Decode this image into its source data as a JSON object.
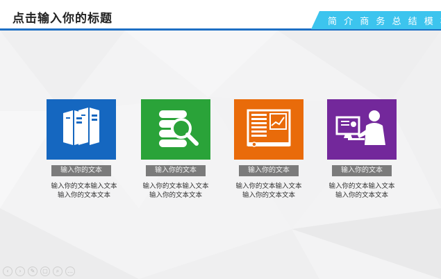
{
  "header": {
    "title": "点击输入你的标题",
    "tag": "简 介 商 务 总 结 模 板"
  },
  "colors": {
    "header_line": "#1d6fc4",
    "tag_bg": "#3cc4ee",
    "card1": "#1567c0",
    "card2": "#2aa339",
    "card3": "#e96b0a",
    "card4": "#73289b"
  },
  "cards": [
    {
      "icon": "server-icon",
      "label": "输入你的文本",
      "desc1": "输入你的文本输入文本",
      "desc2": "输入你的文本文本"
    },
    {
      "icon": "database-search-icon",
      "label": "输入你的文本",
      "desc1": "输入你的文本输入文本",
      "desc2": "输入你的文本文本"
    },
    {
      "icon": "spreadsheet-chart-icon",
      "label": "输入你的文本",
      "desc1": "输入你的文本输入文本",
      "desc2": "输入你的文本文本"
    },
    {
      "icon": "user-computer-icon",
      "label": "输入你的文本",
      "desc1": "输入你的文本输入文本",
      "desc2": "输入你的文本文本"
    }
  ],
  "controls": [
    "previous-icon",
    "next-icon",
    "pen-icon",
    "slides-icon",
    "zoom-icon",
    "more-icon"
  ]
}
